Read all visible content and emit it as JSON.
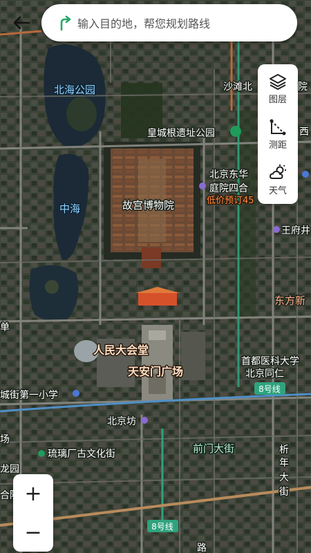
{
  "search": {
    "placeholder": "输入目的地，帮您规划路线"
  },
  "tools": [
    {
      "label": "图层",
      "icon": "layers-icon"
    },
    {
      "label": "测距",
      "icon": "ruler-icon"
    },
    {
      "label": "天气",
      "icon": "weather-icon"
    }
  ],
  "zoom": {
    "in": "+",
    "out": "−"
  },
  "map": {
    "labels": {
      "beihai": "北海公园",
      "zhonghai": "中海",
      "gugong": "故宫博物院",
      "huangcheng": "皇城根遗址公园",
      "shatan": "沙滩北",
      "shatan_edge": "院",
      "xi": "西",
      "dongh1": "北京东华",
      "dongh2": "庭院四合",
      "dongh_promo": "低价预订45",
      "wangfujing": "王府井",
      "dongfang": "东方新",
      "renmin": "人民大会堂",
      "tiananmen": "天安门广场",
      "shoudu": "首都医科大学",
      "tongren": "北京同仁",
      "line8_a": "8号线",
      "line8_b": "8号线",
      "beijingfang": "北京坊",
      "chengjie": "城街第一小学",
      "chang": "场",
      "liulichang": "琉璃厂古文化街",
      "qianmen": "前门大街",
      "xinnian_1": "析",
      "xinnian_2": "年",
      "xinnian_3": "大",
      "xinnian_4": "街",
      "longyuan": "龙园",
      "heyuan": "合院",
      "lu": "路",
      "dan": "单"
    }
  }
}
